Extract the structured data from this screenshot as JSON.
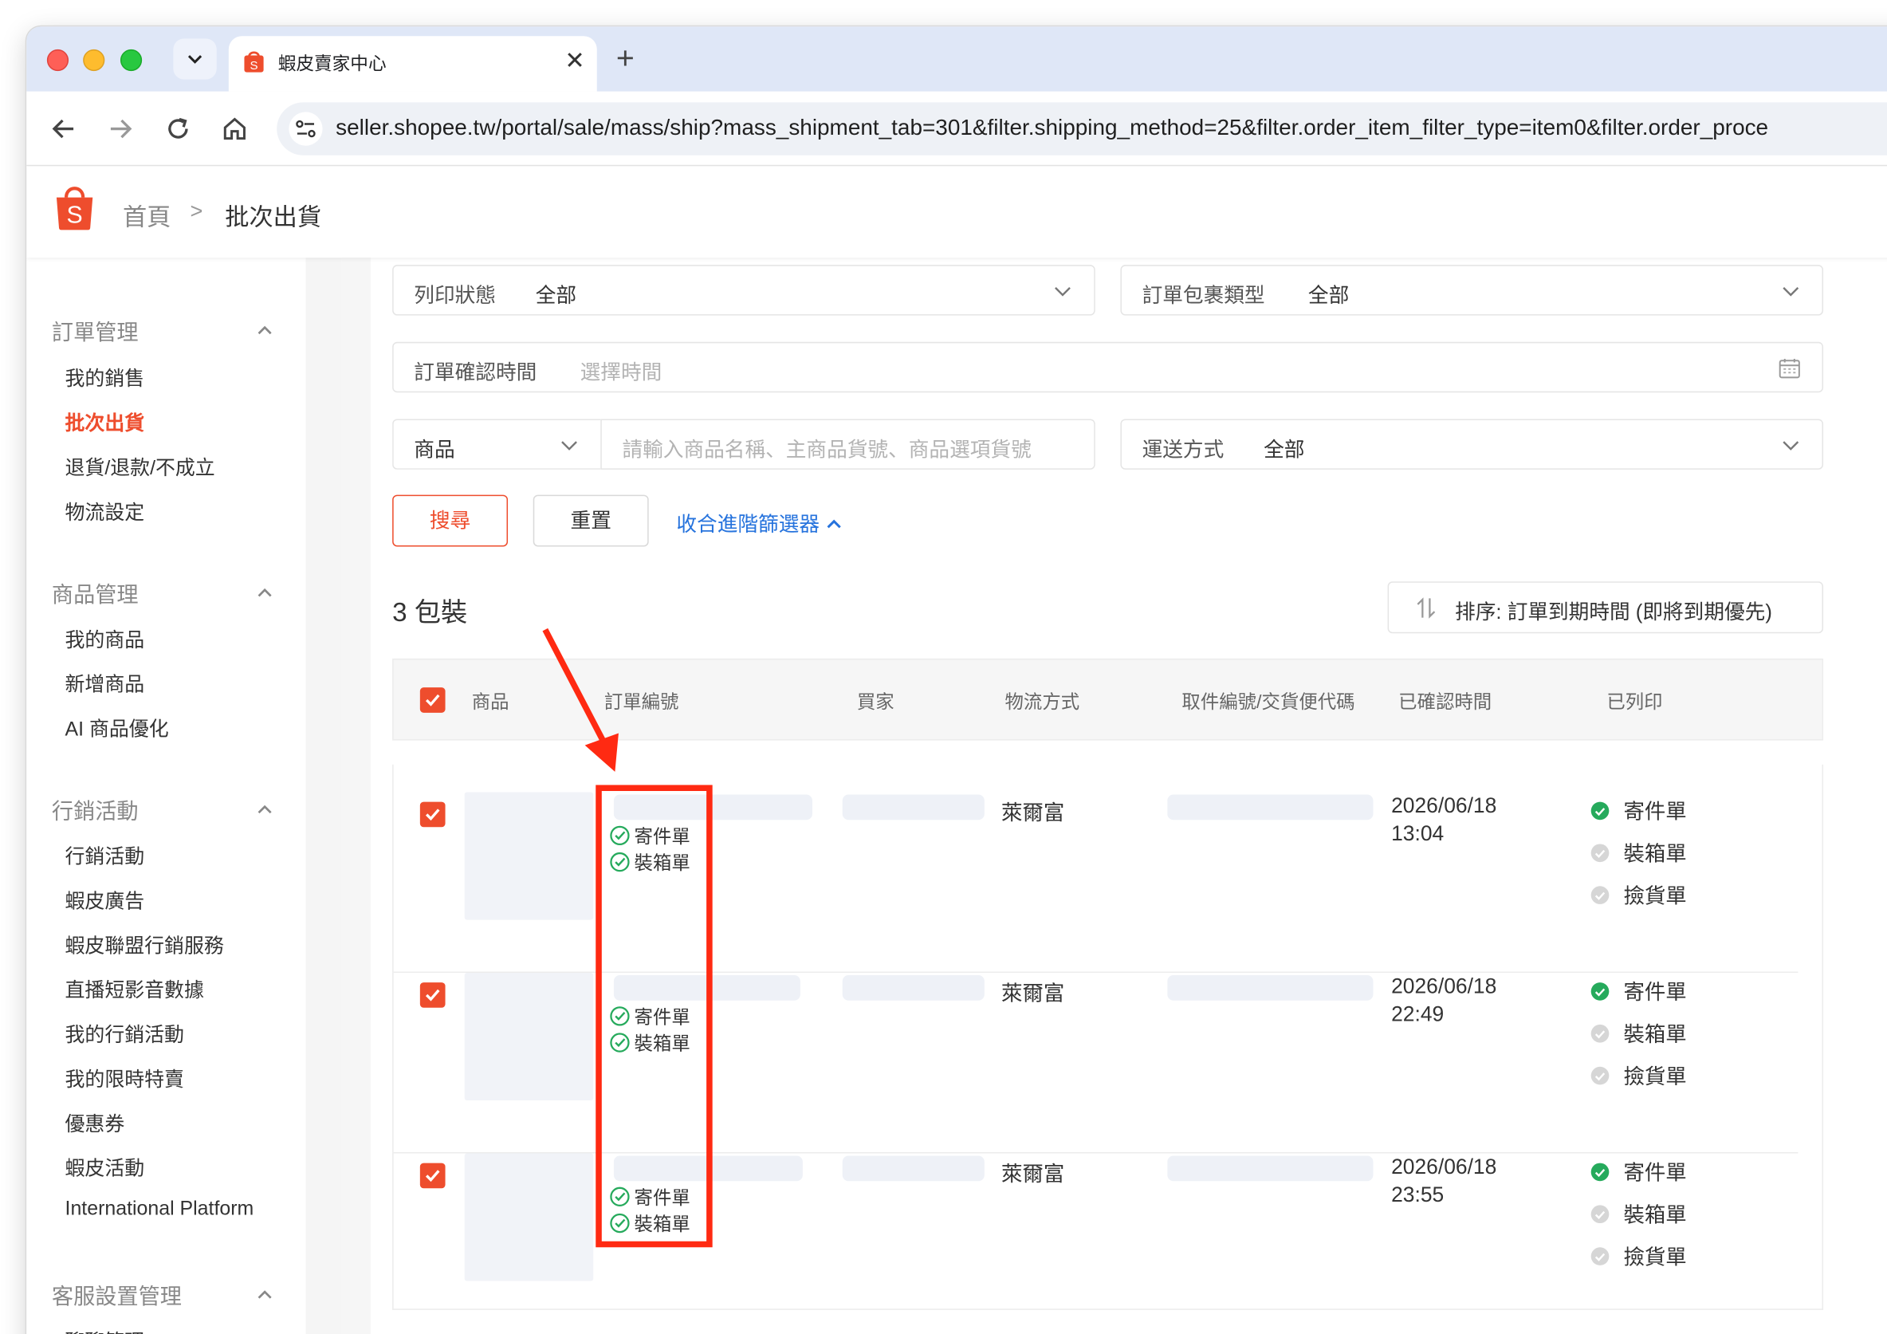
{
  "browser": {
    "tab_title": "蝦皮賣家中心",
    "url": "seller.shopee.tw/portal/sale/mass/ship?mass_shipment_tab=301&filter.shipping_method=25&filter.order_item_filter_type=item0&filter.order_proce"
  },
  "header": {
    "breadcrumb_home": "首頁",
    "breadcrumb_separator": ">",
    "breadcrumb_current": "批次出貨"
  },
  "sidebar": {
    "sections": [
      {
        "title": "訂單管理",
        "items": [
          "我的銷售",
          "批次出貨",
          "退貨/退款/不成立",
          "物流設定"
        ]
      },
      {
        "title": "商品管理",
        "items": [
          "我的商品",
          "新增商品",
          "AI 商品優化"
        ]
      },
      {
        "title": "行銷活動",
        "items": [
          "行銷活動",
          "蝦皮廣告",
          "蝦皮聯盟行銷服務",
          "直播短影音數據",
          "我的行銷活動",
          "我的限時特賣",
          "優惠券",
          "蝦皮活動",
          "International Platform"
        ]
      },
      {
        "title": "客服設置管理",
        "items": [
          "聊聊管理"
        ]
      }
    ],
    "active_item": "批次出貨"
  },
  "filters": {
    "print_status_label": "列印狀態",
    "print_status_value": "全部",
    "package_type_label": "訂單包裹類型",
    "package_type_value": "全部",
    "confirm_time_label": "訂單確認時間",
    "confirm_time_placeholder": "選擇時間",
    "product_select": "商品",
    "product_placeholder": "請輸入商品名稱、主商品貨號、商品選項貨號",
    "shipping_label": "運送方式",
    "shipping_value": "全部",
    "search_button": "搜尋",
    "reset_button": "重置",
    "collapse_link": "收合進階篩選器"
  },
  "results": {
    "count_label": "3 包裝",
    "sort_label": "排序: 訂單到期時間 (即將到期優先)"
  },
  "table": {
    "headers": [
      "商品",
      "訂單編號",
      "買家",
      "物流方式",
      "取件編號/交貨便代碼",
      "已確認時間",
      "已列印"
    ],
    "rows": [
      {
        "order_tags": [
          "寄件單",
          "裝箱單"
        ],
        "logistics": "萊爾富",
        "confirm_date": "2026/06/18",
        "confirm_time": "13:04",
        "printed": [
          {
            "label": "寄件單",
            "done": true
          },
          {
            "label": "裝箱單",
            "done": false
          },
          {
            "label": "撿貨單",
            "done": false
          }
        ]
      },
      {
        "order_tags": [
          "寄件單",
          "裝箱單"
        ],
        "logistics": "萊爾富",
        "confirm_date": "2026/06/18",
        "confirm_time": "22:49",
        "printed": [
          {
            "label": "寄件單",
            "done": true
          },
          {
            "label": "裝箱單",
            "done": false
          },
          {
            "label": "撿貨單",
            "done": false
          }
        ]
      },
      {
        "order_tags": [
          "寄件單",
          "裝箱單"
        ],
        "logistics": "萊爾富",
        "confirm_date": "2026/06/18",
        "confirm_time": "23:55",
        "printed": [
          {
            "label": "寄件單",
            "done": true
          },
          {
            "label": "裝箱單",
            "done": false
          },
          {
            "label": "撿貨單",
            "done": false
          }
        ]
      }
    ]
  },
  "colors": {
    "brand": "#ee4d2d",
    "link": "#2673dd",
    "success": "#26aa5c",
    "annotation": "#ff2a12"
  },
  "icons": [
    "chevron-down-icon",
    "back-arrow-icon",
    "forward-arrow-icon",
    "reload-icon",
    "home-icon",
    "site-settings-icon",
    "shopee-logo-icon",
    "calendar-icon",
    "sort-icon",
    "checkbox-checked-icon",
    "check-circle-icon"
  ]
}
